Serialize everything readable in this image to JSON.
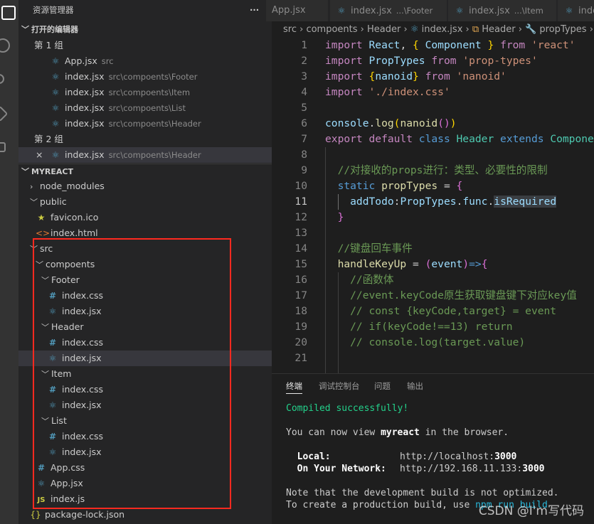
{
  "sidebar": {
    "title": "资源管理器",
    "more": "···",
    "open_editors": "打开的编辑器",
    "group1": "第 1 组",
    "group2": "第 2 组",
    "project": "MYREACT",
    "open_group1": [
      {
        "name": "App.jsx",
        "path": "src"
      },
      {
        "name": "index.jsx",
        "path": "src\\compoents\\Footer"
      },
      {
        "name": "index.jsx",
        "path": "src\\compoents\\Item"
      },
      {
        "name": "index.jsx",
        "path": "src\\compoents\\List"
      },
      {
        "name": "index.jsx",
        "path": "src\\compoents\\Header"
      }
    ],
    "open_group2": [
      {
        "name": "index.jsx",
        "path": "src\\compoents\\Header",
        "close": "×"
      }
    ],
    "tree": [
      {
        "label": "node_modules",
        "level": 1,
        "type": "folder",
        "open": false
      },
      {
        "label": "public",
        "level": 1,
        "type": "folder",
        "open": true
      },
      {
        "label": "favicon.ico",
        "level": 2,
        "type": "star"
      },
      {
        "label": "index.html",
        "level": 2,
        "type": "html"
      },
      {
        "label": "src",
        "level": 1,
        "type": "folder",
        "open": true
      },
      {
        "label": "compoents",
        "level": 2,
        "type": "folder",
        "open": true
      },
      {
        "label": "Footer",
        "level": 3,
        "type": "folder",
        "open": true
      },
      {
        "label": "index.css",
        "level": 4,
        "type": "css"
      },
      {
        "label": "index.jsx",
        "level": 4,
        "type": "react"
      },
      {
        "label": "Header",
        "level": 3,
        "type": "folder",
        "open": true
      },
      {
        "label": "index.css",
        "level": 4,
        "type": "css"
      },
      {
        "label": "index.jsx",
        "level": 4,
        "type": "react",
        "selected": true
      },
      {
        "label": "Item",
        "level": 3,
        "type": "folder",
        "open": true
      },
      {
        "label": "index.css",
        "level": 4,
        "type": "css"
      },
      {
        "label": "index.jsx",
        "level": 4,
        "type": "react"
      },
      {
        "label": "List",
        "level": 3,
        "type": "folder",
        "open": true
      },
      {
        "label": "index.css",
        "level": 4,
        "type": "css"
      },
      {
        "label": "index.jsx",
        "level": 4,
        "type": "react"
      },
      {
        "label": "App.css",
        "level": 2,
        "type": "css"
      },
      {
        "label": "App.jsx",
        "level": 2,
        "type": "react"
      },
      {
        "label": "index.js",
        "level": 2,
        "type": "js"
      },
      {
        "label": "package-lock.json",
        "level": 1,
        "type": "json"
      }
    ]
  },
  "tabs": [
    {
      "name": "App.jsx",
      "desc": ""
    },
    {
      "name": "index.jsx",
      "desc": "...\\Footer"
    },
    {
      "name": "index.jsx",
      "desc": "...\\Item"
    },
    {
      "name": "index.jsx",
      "desc": ""
    }
  ],
  "breadcrumb": [
    "src",
    "compoents",
    "Header",
    "index.jsx",
    "Header",
    "propTypes"
  ],
  "colors": {
    "keyword": "#c586c0",
    "variable": "#9cdcfe",
    "class": "#4ec9b0",
    "string": "#ce9178",
    "comment": "#6a9955",
    "function": "#dcdcaa",
    "storage": "#569cd6",
    "brace1": "#ffd700",
    "brace2": "#da70d6",
    "highlight_box": "#ff2a1f"
  },
  "code": [
    [
      [
        "import ",
        "keyword"
      ],
      [
        "React",
        "variable"
      ],
      [
        ", ",
        "plain"
      ],
      [
        "{",
        "brace1"
      ],
      [
        " Component ",
        "variable"
      ],
      [
        "}",
        "brace1"
      ],
      [
        " from ",
        "keyword"
      ],
      [
        "'react'",
        "string"
      ]
    ],
    [
      [
        "import ",
        "keyword"
      ],
      [
        "PropTypes",
        "variable"
      ],
      [
        " from ",
        "keyword"
      ],
      [
        "'prop-types'",
        "string"
      ]
    ],
    [
      [
        "import ",
        "keyword"
      ],
      [
        "{",
        "brace1"
      ],
      [
        "nanoid",
        "variable"
      ],
      [
        "}",
        "brace1"
      ],
      [
        " from ",
        "keyword"
      ],
      [
        "'nanoid'",
        "string"
      ]
    ],
    [
      [
        "import ",
        "keyword"
      ],
      [
        "'./index.css'",
        "string"
      ]
    ],
    [],
    [
      [
        "console",
        "variable"
      ],
      [
        ".",
        "plain"
      ],
      [
        "log",
        "function"
      ],
      [
        "(",
        "brace1"
      ],
      [
        "nanoid",
        "function"
      ],
      [
        "()",
        "brace2"
      ],
      [
        ")",
        "brace1"
      ]
    ],
    [
      [
        "export default ",
        "keyword"
      ],
      [
        "class ",
        "storage"
      ],
      [
        "Header ",
        "class"
      ],
      [
        "extends ",
        "storage"
      ],
      [
        "Component",
        "class"
      ]
    ],
    [],
    [
      [
        "  //对接收的props进行：类型、必要性的限制",
        "comment"
      ]
    ],
    [
      [
        "  static ",
        "storage"
      ],
      [
        "propTypes",
        "function"
      ],
      [
        " = ",
        "plain"
      ],
      [
        "{",
        "brace2"
      ]
    ],
    [
      [
        "    addTodo",
        "variable"
      ],
      [
        ":",
        "plain"
      ],
      [
        "PropTypes",
        "variable"
      ],
      [
        ".",
        "plain"
      ],
      [
        "func",
        "variable"
      ],
      [
        ".",
        "plain"
      ],
      [
        "isRequired",
        "selected"
      ]
    ],
    [
      [
        "  }",
        "brace2"
      ]
    ],
    [],
    [
      [
        "  //键盘回车事件",
        "comment"
      ]
    ],
    [
      [
        "  handleKeyUp",
        "function"
      ],
      [
        " = ",
        "plain"
      ],
      [
        "(",
        "brace2"
      ],
      [
        "event",
        "variable"
      ],
      [
        ")",
        "brace2"
      ],
      [
        "=>",
        "storage"
      ],
      [
        "{",
        "brace2"
      ]
    ],
    [
      [
        "    //函数体",
        "comment"
      ]
    ],
    [
      [
        "    //event.keyCode原生获取键盘键下对应key值",
        "comment"
      ]
    ],
    [
      [
        "    // const {keyCode,target} = event",
        "comment"
      ]
    ],
    [
      [
        "    // if(keyCode!==13) return",
        "comment"
      ]
    ],
    [
      [
        "    // console.log(target.value)",
        "comment"
      ]
    ],
    []
  ],
  "current_line": 11,
  "panel": {
    "tabs": [
      "终端",
      "调试控制台",
      "问题",
      "输出"
    ],
    "active": 0,
    "terminal": {
      "compiled": "Compiled successfully!",
      "view_pre": "You can now view ",
      "app": "myreact",
      "view_post": " in the browser.",
      "local_label": "  Local:",
      "local_url_pre": "http://localhost:",
      "port": "3000",
      "network_label": "  On Your Network:",
      "network_url_pre": "http://192.168.11.133:",
      "note": "Note that the development build is not optimized.",
      "create_pre": "To create a production build, use ",
      "create_cmd": "npm run build"
    }
  },
  "watermark": "CSDN @I'm写代码"
}
